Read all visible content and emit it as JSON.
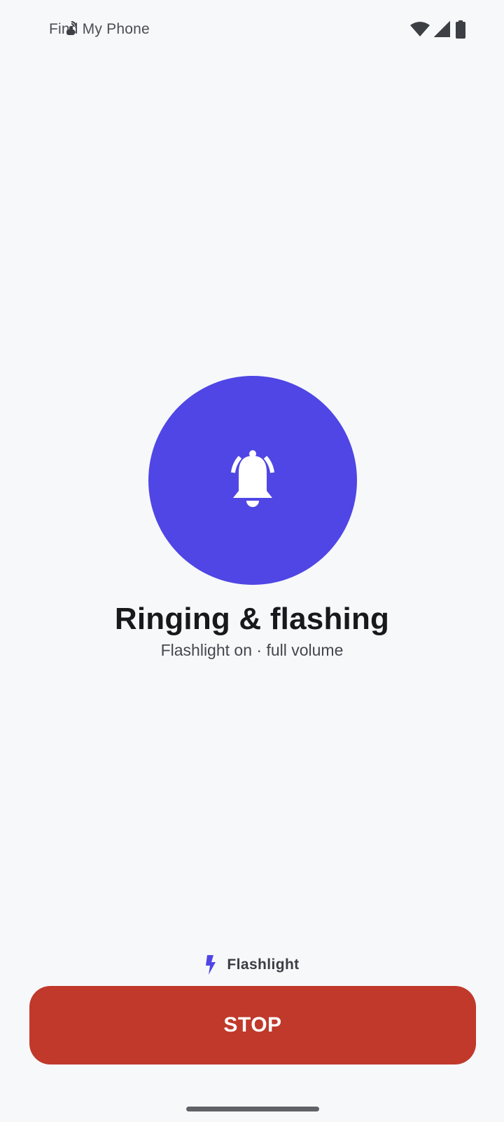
{
  "status_bar": {
    "app_title": "Find My Phone",
    "icons": [
      "notification-hand-icon",
      "wifi-icon",
      "cellular-signal-icon",
      "battery-icon"
    ]
  },
  "alert": {
    "icon": "bell-ringing-icon",
    "circle_color": "#4f46e5",
    "title": "Ringing & flashing",
    "subtitle": "Flashlight on · full volume"
  },
  "flashlight": {
    "icon": "lightning-bolt-icon",
    "label": "Flashlight",
    "icon_color": "#4f46e5"
  },
  "stop_button": {
    "label": "STOP",
    "color": "#c0392b"
  }
}
